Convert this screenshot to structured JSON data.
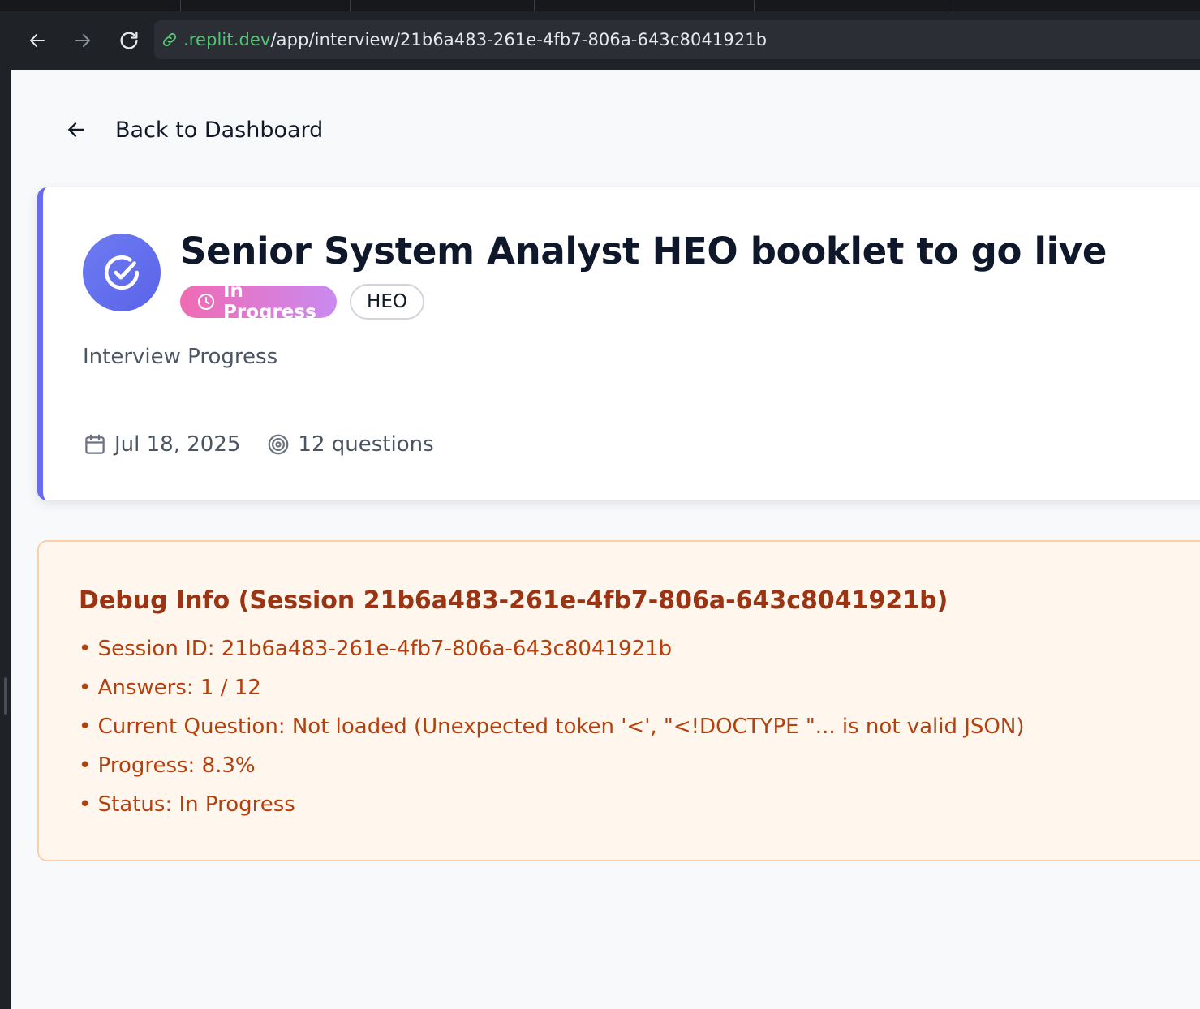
{
  "browser": {
    "url_domain": ".replit.dev",
    "url_path": "/app/interview/21b6a483-261e-4fb7-806a-643c8041921b"
  },
  "nav": {
    "back_label": "Back to Dashboard"
  },
  "interview": {
    "title": "Senior System Analyst HEO booklet to go live",
    "status_badge": "In Progress",
    "level_badge": "HEO",
    "subtitle": "Interview Progress",
    "date": "Jul 18, 2025",
    "questions": "12 questions"
  },
  "debug": {
    "title": "Debug Info (Session 21b6a483-261e-4fb7-806a-643c8041921b)",
    "items": [
      "• Session ID: 21b6a483-261e-4fb7-806a-643c8041921b",
      "• Answers: 1 / 12",
      "• Current Question: Not loaded (Unexpected token '<', \"<!DOCTYPE \"... is not valid JSON)",
      "• Progress: 8.3%",
      "• Status: In Progress"
    ]
  },
  "colors": {
    "accent": "#6a6cf0",
    "status_gradient_start": "#f06bb3",
    "status_gradient_end": "#c98af0",
    "debug_text": "#9a3412",
    "debug_bg": "#fff6ee",
    "url_domain": "#4ecb71"
  }
}
